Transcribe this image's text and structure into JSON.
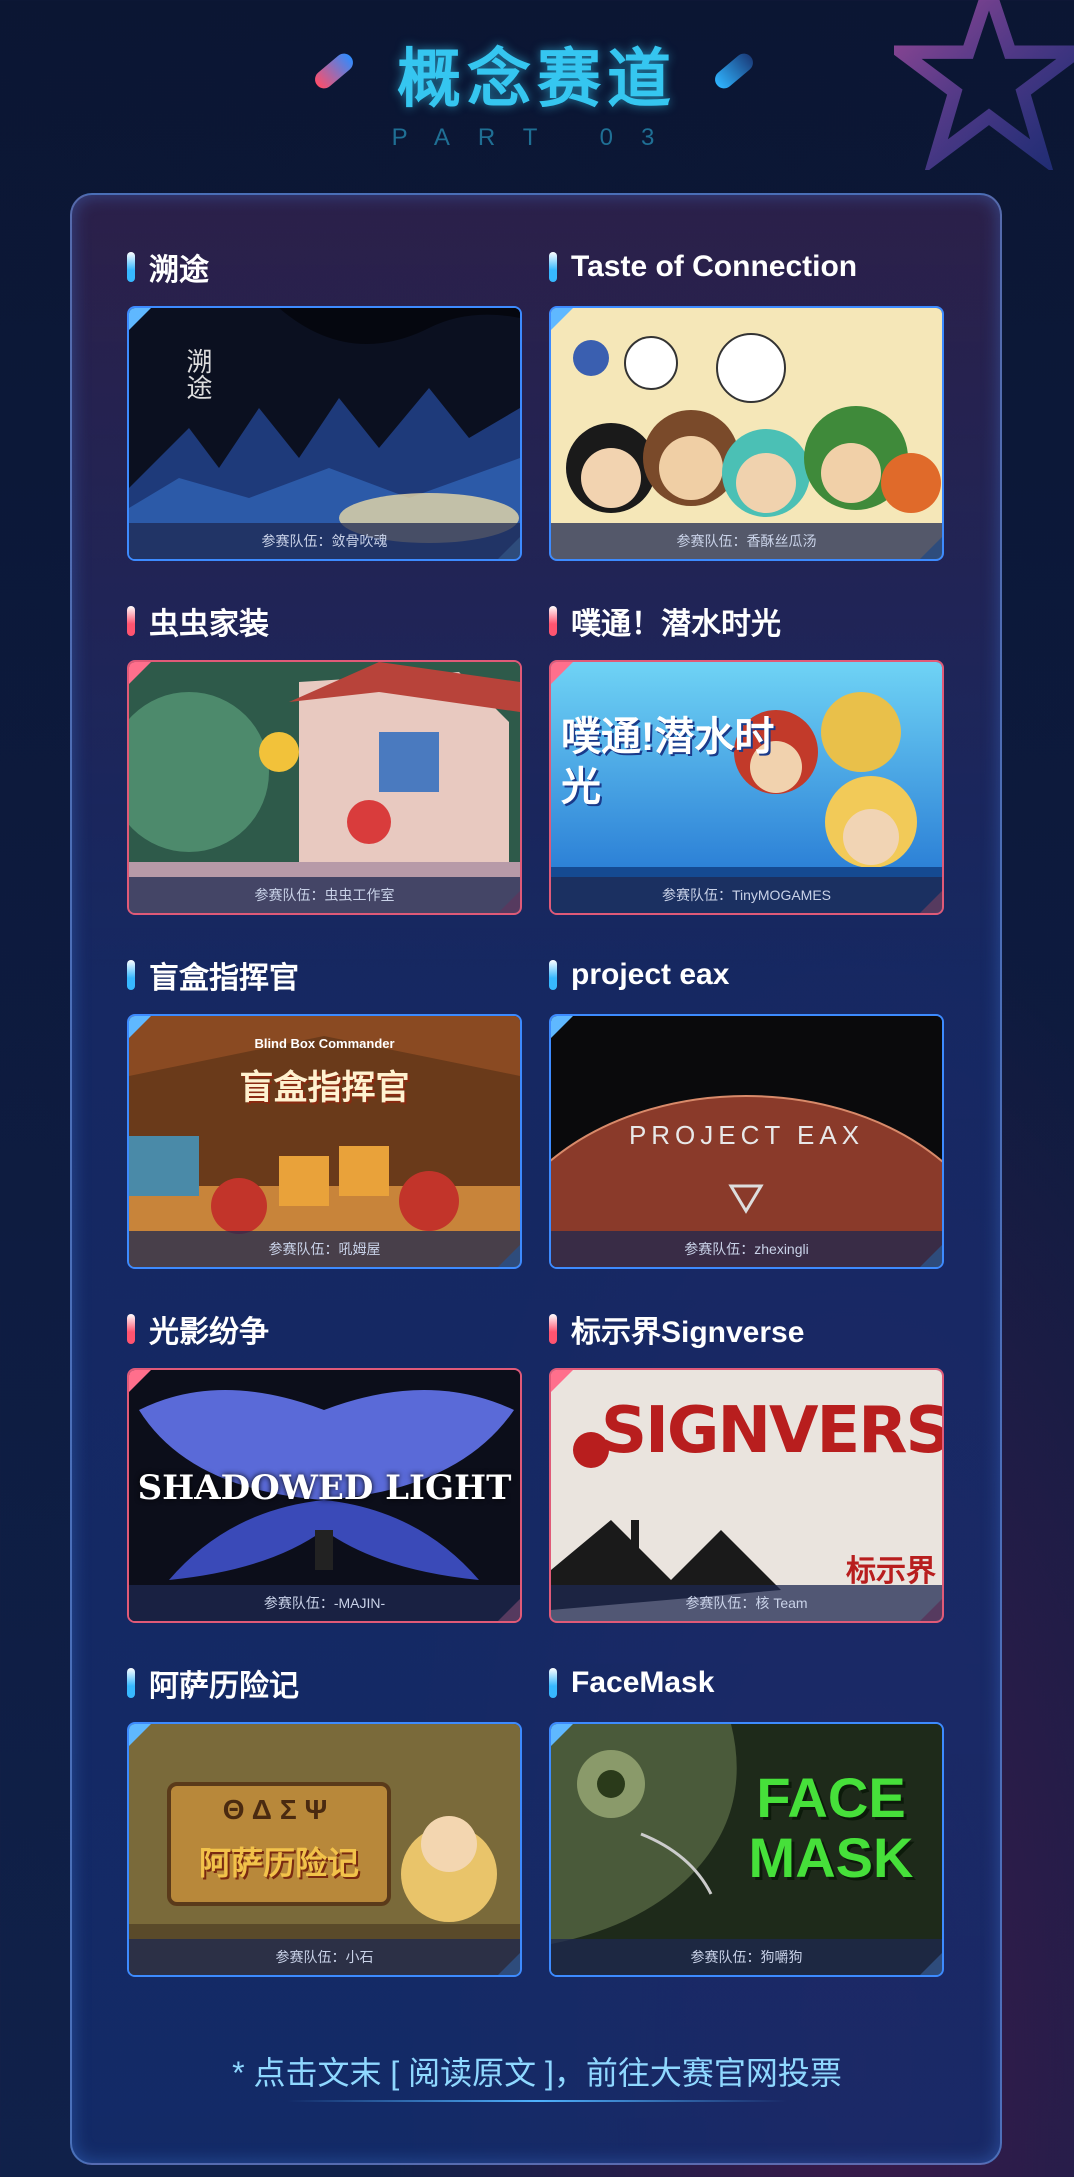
{
  "header": {
    "title": "概念赛道",
    "subtitle": "PART 03"
  },
  "colors": {
    "title": "#35c6f0",
    "blue_accent": "#3d8bff",
    "red_accent": "#e05a78"
  },
  "entries": [
    {
      "title": "溯途",
      "team": "参赛队伍：敛骨吹魂",
      "accent": "blue",
      "art_text": "溯途"
    },
    {
      "title": "Taste of Connection",
      "team": "参赛队伍：香酥丝瓜汤",
      "accent": "blue",
      "art_text": ""
    },
    {
      "title": "虫虫家装",
      "team": "参赛队伍：虫虫工作室",
      "accent": "red",
      "art_text": ""
    },
    {
      "title": "噗通！潜水时光",
      "team": "参赛队伍：TinyMOGAMES",
      "accent": "red",
      "art_text": "噗通!潜水时光"
    },
    {
      "title": "盲盒指挥官",
      "team": "参赛队伍：吼姆屋",
      "accent": "blue",
      "art_text": "盲盒指挥官",
      "art_text_small": "Blind Box Commander"
    },
    {
      "title": "project eax",
      "team": "参赛队伍：zhexingli",
      "accent": "blue",
      "art_text": "PROJECT EAX"
    },
    {
      "title": "光影纷争",
      "team": "参赛队伍：-MAJIN-",
      "accent": "red",
      "art_text": "SHADOWED LIGHT"
    },
    {
      "title": "标示界Signverse",
      "team": "参赛队伍：核 Team",
      "accent": "red",
      "art_text": "SIGNVERSE",
      "art_text_small": "标示界"
    },
    {
      "title": "阿萨历险记",
      "team": "参赛队伍：小石",
      "accent": "blue",
      "art_text": "阿萨历险记",
      "art_text_small": "ΘΔΣΨ"
    },
    {
      "title": "FaceMask",
      "team": "参赛队伍：狗嚼狗",
      "accent": "blue",
      "art_text": "FACE MASK"
    }
  ],
  "footer": {
    "text": "* 点击文末 [ 阅读原文 ]，前往大赛官网投票"
  }
}
